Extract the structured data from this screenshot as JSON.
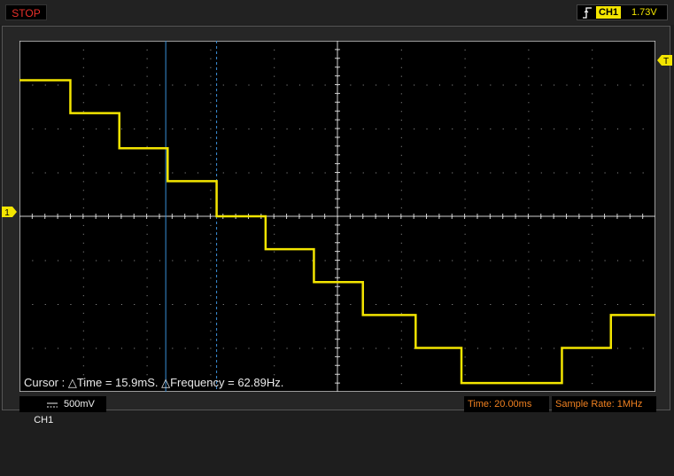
{
  "status": {
    "run_state": "STOP"
  },
  "trigger": {
    "channel": "CH1",
    "level": "1.73V",
    "edge_icon": "rising-edge-icon"
  },
  "markers": {
    "channel_marker": "1",
    "trigger_marker": "T"
  },
  "cursor": {
    "readout": "Cursor : △Time = 15.9mS. △Frequency = 62.89Hz."
  },
  "bottom": {
    "channel_label": "CH1",
    "coupling_icon": "dc-coupling-icon",
    "volts_per_div": "500mV",
    "time_per_div": "Time: 20.00ms",
    "sample_rate": "Sample Rate: 1MHz"
  },
  "colors": {
    "trace": "#f3e500",
    "cursor_line": "#3a8fd8",
    "grid": "#d0d0d0",
    "status_orange": "#f08020",
    "stop_red": "#e8302a"
  },
  "waveform": {
    "description_units": "divisions relative to center (500mV/div), time in divisions (20ms/div)",
    "steps": [
      {
        "t0": -5.0,
        "t1": -4.2,
        "level": 3.1
      },
      {
        "t0": -4.2,
        "t1": -3.43,
        "level": 2.35
      },
      {
        "t0": -3.43,
        "t1": -2.67,
        "level": 1.55
      },
      {
        "t0": -2.67,
        "t1": -1.9,
        "level": 0.8
      },
      {
        "t0": -1.9,
        "t1": -1.13,
        "level": 0.0
      },
      {
        "t0": -1.13,
        "t1": -0.37,
        "level": -0.75
      },
      {
        "t0": -0.37,
        "t1": 0.4,
        "level": -1.5
      },
      {
        "t0": 0.4,
        "t1": 1.23,
        "level": -2.25
      },
      {
        "t0": 1.23,
        "t1": 1.95,
        "level": -3.0
      },
      {
        "t0": 1.95,
        "t1": 3.53,
        "level": -3.8
      },
      {
        "t0": 3.53,
        "t1": 4.3,
        "level": -3.0
      },
      {
        "t0": 4.3,
        "t1": 5.0,
        "level": -2.25
      }
    ],
    "cursor_a_time": -2.7,
    "cursor_b_time": -1.9
  }
}
